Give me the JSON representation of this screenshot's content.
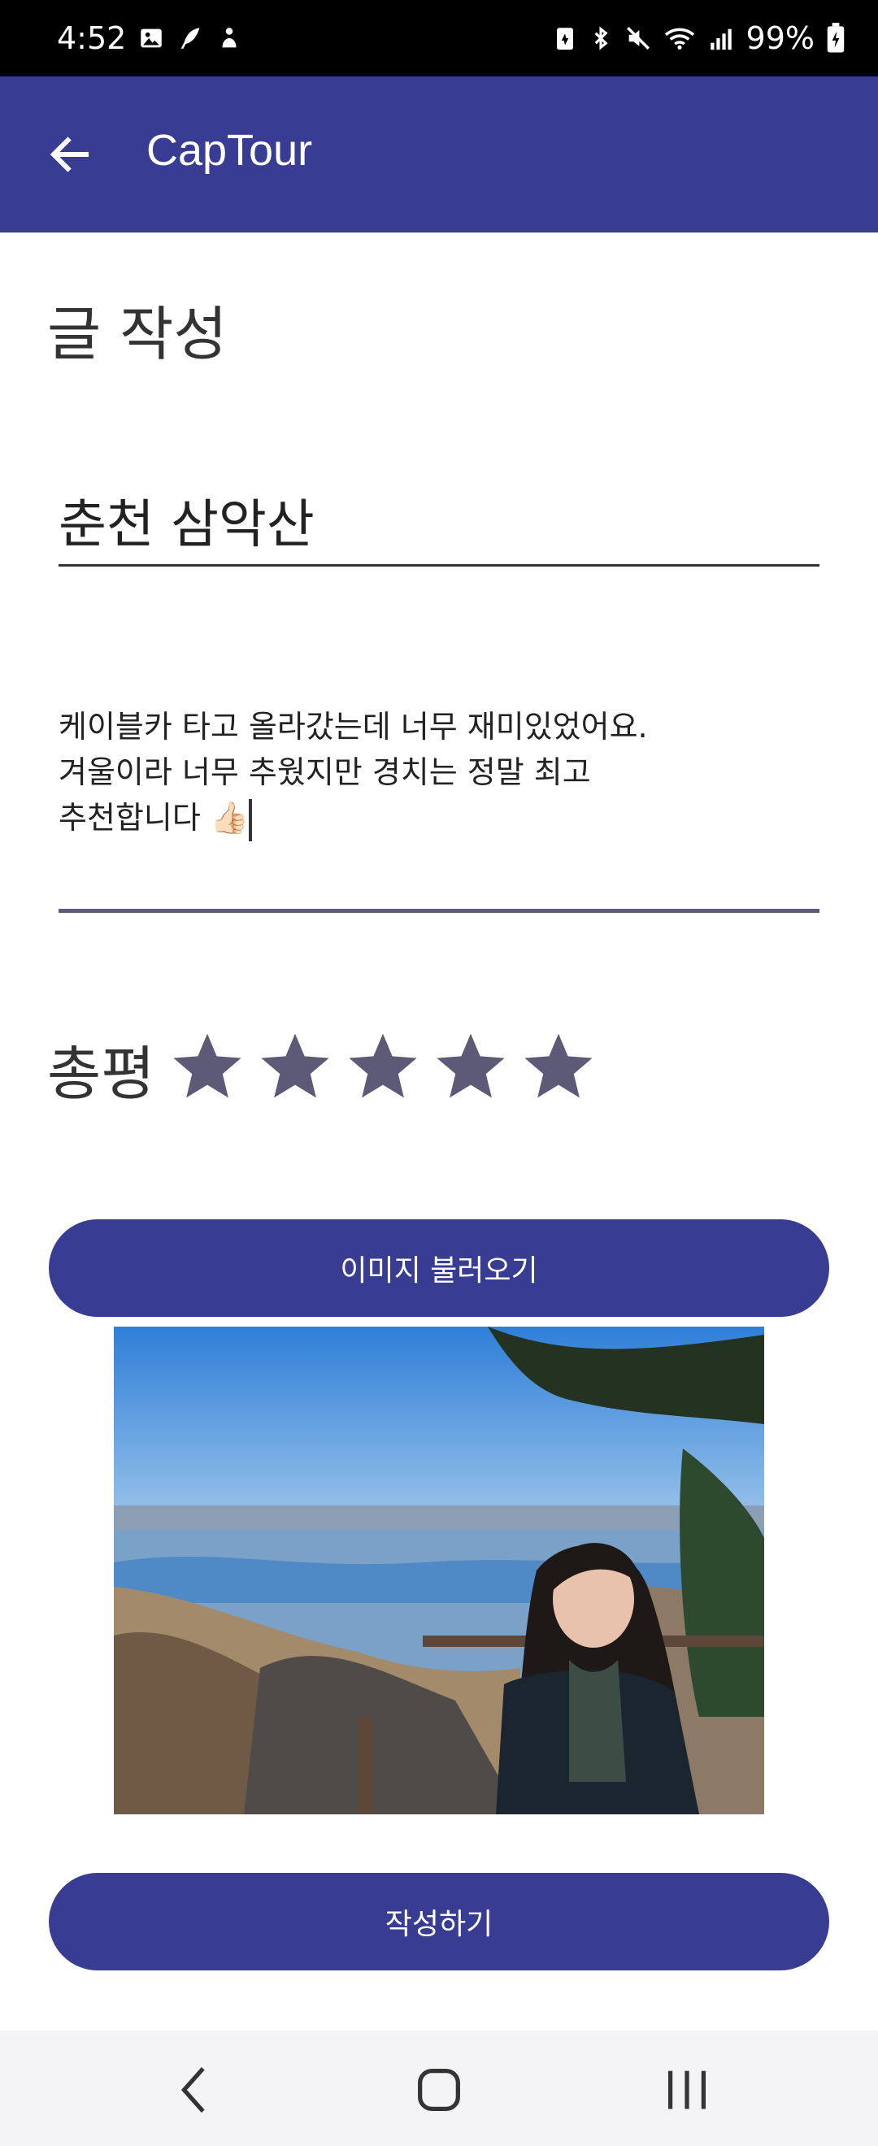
{
  "status_bar": {
    "time": "4:52",
    "battery": "99%",
    "left_icons": [
      "image-icon",
      "feather-icon",
      "notification-icon"
    ],
    "right_icons": [
      "battery-saver-icon",
      "bluetooth-icon",
      "mute-icon",
      "wifi-icon",
      "signal-icon",
      "battery-icon"
    ]
  },
  "app_bar": {
    "title": "CapTour",
    "back_icon": "arrow-left-icon",
    "color": "#383c93"
  },
  "page": {
    "title": "글 작성"
  },
  "form": {
    "title_value": "춘천 삼악산",
    "body_value": "케이블카 타고 올라갔는데 너무 재미있었어요.\n겨울이라 너무 추웠지만 경치는 정말 최고\n추천합니다 👍🏻",
    "rating_label": "총평",
    "rating": 5,
    "rating_max": 5,
    "star_color": "#5d5a77"
  },
  "buttons": {
    "load_image": "이미지 불러오기",
    "submit": "작성하기"
  },
  "photo": {
    "description_icon": "uploaded-photo"
  },
  "nav_bar": {
    "back_icon": "chevron-left-icon",
    "home_icon": "home-square-icon",
    "recents_icon": "recents-icon"
  }
}
